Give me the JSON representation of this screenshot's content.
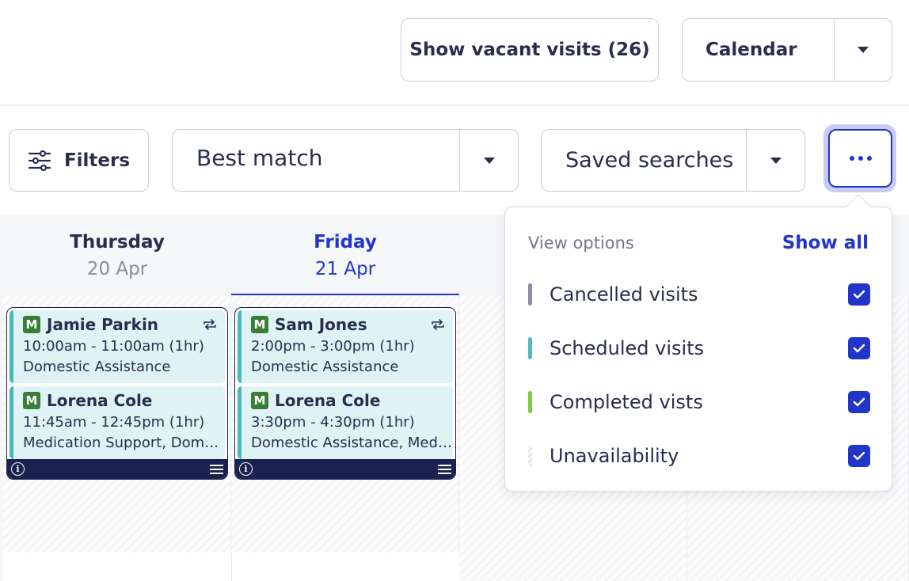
{
  "topbar": {
    "vacant_label": "Show vacant visits (26)",
    "calendar_label": "Calendar"
  },
  "filterbar": {
    "filters_label": "Filters",
    "sort_label": "Best match",
    "saved_label": "Saved searches"
  },
  "days": [
    {
      "name": "Thursday",
      "date": "20 Apr"
    },
    {
      "name": "Friday",
      "date": "21 Apr"
    }
  ],
  "visits": {
    "thu": [
      {
        "badge": "M",
        "name": "Jamie Parkin",
        "time": "10:00am - 11:00am (1hr)",
        "service": "Domestic Assistance"
      },
      {
        "badge": "M",
        "name": "Lorena Cole",
        "time": "11:45am - 12:45pm (1hr)",
        "service": "Medication Support, Domestic Assistance"
      }
    ],
    "fri": [
      {
        "badge": "M",
        "name": "Sam Jones",
        "time": "2:00pm - 3:00pm (1hr)",
        "service": "Domestic Assistance"
      },
      {
        "badge": "M",
        "name": "Lorena Cole",
        "time": "3:30pm - 4:30pm (1hr)",
        "service": "Domestic Assistance, Medication Support"
      }
    ]
  },
  "view_options": {
    "title": "View options",
    "show_all": "Show all",
    "items": [
      {
        "label": "Cancelled visits",
        "color": "#8b8ea6",
        "checked": true
      },
      {
        "label": "Scheduled visits",
        "color": "#4fbcc4",
        "checked": true
      },
      {
        "label": "Completed vists",
        "color": "#7ccc3f",
        "checked": true
      },
      {
        "label": "Unavailability",
        "color": "hatched",
        "checked": true
      }
    ]
  },
  "colors": {
    "accent": "#2235c9",
    "card_dark": "#1c2250",
    "visit_bg": "#dff3f5",
    "visit_border": "#49b8c0",
    "badge": "#3a7d3a"
  }
}
